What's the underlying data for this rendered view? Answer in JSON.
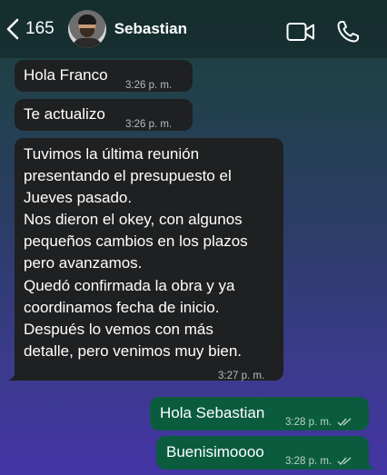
{
  "header": {
    "back_count": "165",
    "contact_name": "Sebastian"
  },
  "messages": [
    {
      "direction": "in",
      "text": "Hola Franco",
      "time": "3:26 p. m."
    },
    {
      "direction": "in",
      "text": "Te actualizo",
      "time": "3:26 p. m."
    },
    {
      "direction": "in",
      "text": "Tuvimos la última reunión\npresentando el presupuesto el\nJueves pasado.\nNos dieron el okey, con algunos\npequeños cambios en los plazos\npero avanzamos.\nQuedó confirmada la obra y ya\ncoordinamos fecha de inicio.\nDespués lo vemos con más\ndetalle, pero venimos muy bien.",
      "time": "3:27 p. m."
    },
    {
      "direction": "out",
      "text": "Hola Sebastian",
      "time": "3:28 p. m."
    },
    {
      "direction": "out",
      "text": "Buenisimoooo",
      "time": "3:28 p. m."
    }
  ],
  "icons": {
    "back": "chevron-left-icon",
    "video": "video-camera-icon",
    "call": "phone-icon",
    "read_receipt": "double-check-icon"
  },
  "colors": {
    "incoming_bubble": "#1f2021",
    "outgoing_bubble": "#0b5c3f",
    "header": "#142828"
  }
}
